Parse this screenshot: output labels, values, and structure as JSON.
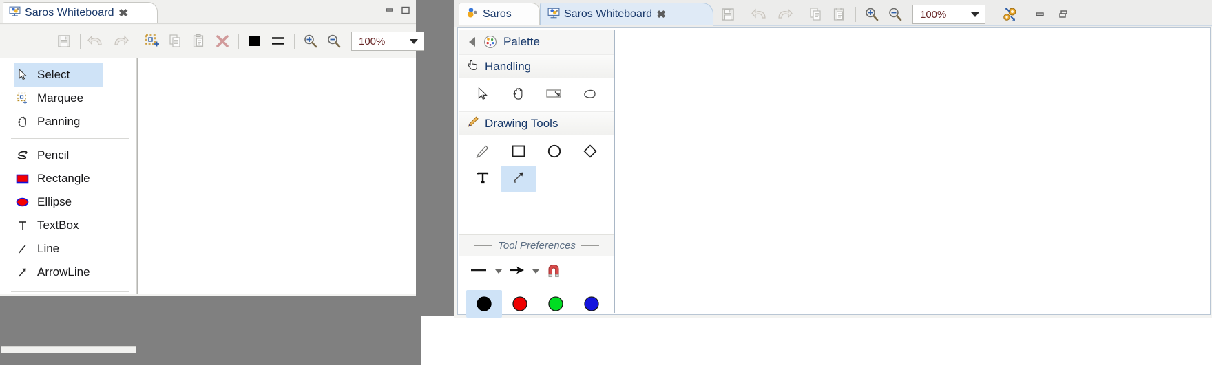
{
  "left_window": {
    "tab": {
      "label": "Saros Whiteboard",
      "close_glyph": "✖",
      "icon": "whiteboard-icon"
    },
    "window_controls": {
      "minimize": "minimize-icon",
      "maximize": "maximize-icon"
    },
    "toolbar": {
      "save_label": "save-icon",
      "undo_label": "undo-icon",
      "redo_label": "redo-icon",
      "marquee_label": "marquee-select-icon",
      "copy_label": "copy-icon",
      "paste_label": "paste-icon",
      "delete_label": "delete-icon",
      "color_label": "foreground-color-swatch",
      "linestyle_label": "line-style-icon",
      "zoom_in_label": "zoom-in-icon",
      "zoom_out_label": "zoom-out-icon",
      "zoom_value": "100%"
    },
    "tools": [
      {
        "label": "Select",
        "icon": "cursor-arrow-icon",
        "selected": true
      },
      {
        "label": "Marquee",
        "icon": "marquee-icon",
        "selected": false
      },
      {
        "label": "Panning",
        "icon": "hand-icon",
        "selected": false
      },
      {
        "label": "Pencil",
        "icon": "pencil-scribble-icon",
        "selected": false
      },
      {
        "label": "Rectangle",
        "icon": "rectangle-icon",
        "selected": false
      },
      {
        "label": "Ellipse",
        "icon": "ellipse-icon",
        "selected": false
      },
      {
        "label": "TextBox",
        "icon": "text-icon",
        "selected": false
      },
      {
        "label": "Line",
        "icon": "line-icon",
        "selected": false
      },
      {
        "label": "ArrowLine",
        "icon": "arrow-line-icon",
        "selected": false
      }
    ]
  },
  "right_window": {
    "tabs": [
      {
        "label": "Saros",
        "icon": "saros-icon",
        "active": false,
        "closable": false
      },
      {
        "label": "Saros Whiteboard",
        "icon": "whiteboard-icon",
        "active": true,
        "closable": true,
        "close_glyph": "✖"
      }
    ],
    "toolbar": {
      "save_label": "save-icon",
      "undo_label": "undo-icon",
      "redo_label": "redo-icon",
      "copy_label": "copy-icon",
      "paste_label": "paste-icon",
      "zoom_in_label": "zoom-in-icon",
      "zoom_out_label": "zoom-out-icon",
      "zoom_value": "100%",
      "settings_label": "gears-icon",
      "minimize_label": "minimize-icon",
      "restore_label": "restore-icon"
    },
    "palette": {
      "title": "Palette",
      "collapse_icon": "collapse-left-arrow-icon",
      "palette_icon": "palette-icon",
      "drawers": [
        {
          "title": "Handling",
          "icon": "pointing-hand-icon",
          "items": [
            {
              "icon": "cursor-arrow-icon",
              "selected": false
            },
            {
              "icon": "hand-icon",
              "selected": false
            },
            {
              "icon": "marquee-icon",
              "selected": false
            },
            {
              "icon": "eraser-icon",
              "selected": false
            }
          ]
        },
        {
          "title": "Drawing Tools",
          "icon": "pencil-icon",
          "items": [
            {
              "icon": "pencil-icon",
              "selected": false
            },
            {
              "icon": "rectangle-outline-icon",
              "selected": false
            },
            {
              "icon": "ellipse-outline-icon",
              "selected": false
            },
            {
              "icon": "diamond-outline-icon",
              "selected": false
            },
            {
              "icon": "text-icon",
              "selected": false
            },
            {
              "icon": "arrow-line-icon",
              "selected": true
            }
          ]
        }
      ],
      "preferences": {
        "title": "Tool Preferences",
        "items": [
          {
            "icon": "line-width-icon",
            "has_dropdown": true
          },
          {
            "icon": "arrowhead-icon",
            "has_dropdown": true
          },
          {
            "icon": "magnet-snap-icon",
            "has_dropdown": false
          }
        ]
      },
      "colors": [
        {
          "name": "black",
          "hex": "#000000",
          "selected": true
        },
        {
          "name": "red",
          "hex": "#ee0000",
          "selected": false
        },
        {
          "name": "green",
          "hex": "#00dd22",
          "selected": false
        },
        {
          "name": "blue",
          "hex": "#1414dd",
          "selected": false
        }
      ]
    }
  }
}
